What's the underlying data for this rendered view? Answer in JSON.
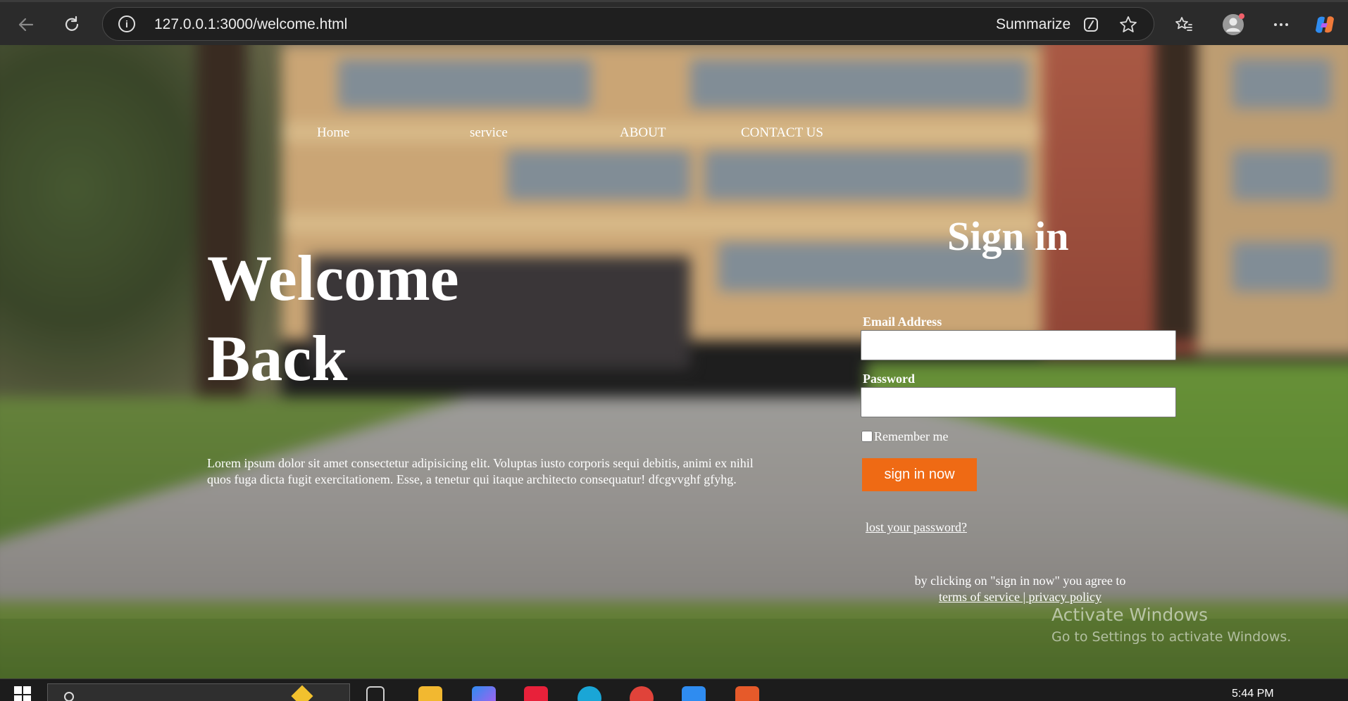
{
  "browser": {
    "url": "127.0.0.1:3000/welcome.html",
    "summarize_label": "Summarize",
    "icons": [
      "back-arrow-icon",
      "refresh-icon",
      "info-icon",
      "copilot-summarize-icon",
      "favorite-star-icon",
      "favorites-icon",
      "profile-icon",
      "more-icon",
      "copilot-icon"
    ]
  },
  "nav": {
    "items": [
      "Home",
      "service",
      "ABOUT",
      "CONTACT US"
    ]
  },
  "hero": {
    "title_line1": "Welcome",
    "title_line2": "Back",
    "text": "Lorem ipsum dolor sit amet consectetur adipisicing elit. Voluptas iusto corporis sequi debitis, animi ex nihil quos fuga dicta fugit exercitationem. Esse, a tenetur qui itaque architecto consequatur! dfcgvvghf gfyhg."
  },
  "form": {
    "title": "Sign in",
    "email_label": "Email Address",
    "email_value": "",
    "password_label": "Password",
    "password_value": "",
    "remember_label": "Remember me",
    "submit_label": "sign in now",
    "lost_password": "lost your password?",
    "agree_text": "by clicking on \"sign in now\" you agree to",
    "terms_label": "terms of service",
    "separator": " | ",
    "privacy_label": "privacy policy"
  },
  "watermark": {
    "line1": "Activate Windows",
    "line2": "Go to Settings to activate Windows."
  },
  "taskbar": {
    "time": "5:44 PM",
    "apps": [
      "start-icon",
      "search-icon",
      "task-view-icon",
      "file-explorer-icon",
      "microsoft-365-icon",
      "app-red-icon",
      "edge-icon",
      "chrome-icon",
      "vscode-icon",
      "app-orange-icon"
    ]
  },
  "colors": {
    "accent": "#ef6a14",
    "chrome_bg": "#2b2b2b",
    "text": "#ffffff"
  }
}
